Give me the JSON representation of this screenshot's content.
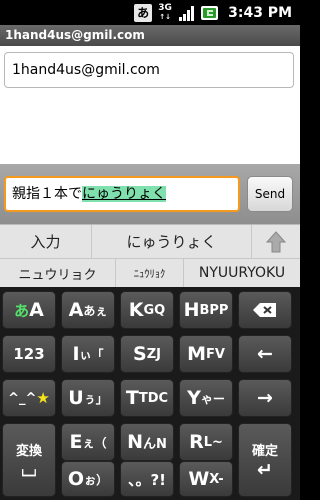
{
  "status_bar": {
    "ime_indicator": "あ",
    "network_3g_top": "3G",
    "network_3g_bottom": "↑↓",
    "time": "3:43 PM",
    "icons": [
      "ime-icon",
      "3g-icon",
      "signal-icon",
      "battery-icon"
    ]
  },
  "title_bar": {
    "title": "1hand4us@gmil.com"
  },
  "conversation": {
    "message": "1hand4us@gmil.com"
  },
  "compose": {
    "committed_text": "親指１本で",
    "composing_text": "にゅうりょく",
    "send_label": "Send"
  },
  "candidates": {
    "row1": [
      "入力",
      "にゅうりょく"
    ],
    "row2": [
      "ニュウリョク",
      "ﾆｭｳﾘｮｸ",
      "NYUURYOKU"
    ],
    "expand_icon": "arrow-up-icon"
  },
  "keyboard": {
    "keys": {
      "mode_hira": {
        "main": "あ",
        "sub": "A"
      },
      "a": {
        "main": "A",
        "sub": "あぇ"
      },
      "k": {
        "main": "K",
        "sub": "GQ"
      },
      "h": {
        "main": "H",
        "sub": "BPP"
      },
      "backspace": "backspace-icon",
      "num": {
        "main": "123"
      },
      "i": {
        "main": "I",
        "sub": "ぃ「"
      },
      "s": {
        "main": "S",
        "sub": "ZJ"
      },
      "m": {
        "main": "M",
        "sub": "FV"
      },
      "left": "←",
      "emoji": {
        "main": "^_^",
        "sub": "★"
      },
      "u": {
        "main": "U",
        "sub": "ぅ」"
      },
      "t": {
        "main": "T",
        "sub": "TDC"
      },
      "y": {
        "main": "Y",
        "sub": "ゃー"
      },
      "right": "→",
      "henkan": {
        "main": "変換",
        "sub": "⌴"
      },
      "e": {
        "main": "E",
        "sub": "ぇ（"
      },
      "n": {
        "main": "N",
        "sub": "んN"
      },
      "r": {
        "main": "R",
        "sub": "L~"
      },
      "kakutei": {
        "main": "確定",
        "sub": "↵"
      },
      "o": {
        "main": "O",
        "sub": "ぉ）"
      },
      "punct": {
        "main": "、。?!"
      },
      "w": {
        "main": "W",
        "sub": "X-"
      }
    }
  },
  "colors": {
    "focus_border": "#f39a1f",
    "composition_highlight": "#7fe0ad",
    "key_bg": "#4a4a4a",
    "mode_accent": "#54e06a",
    "star": "#f5e31c"
  }
}
